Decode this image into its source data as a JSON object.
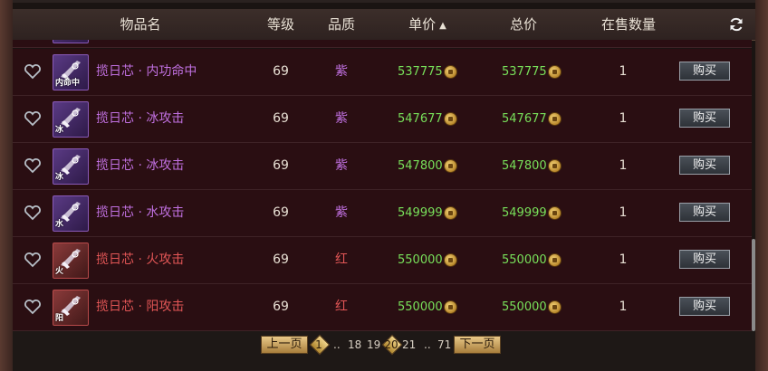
{
  "header": {
    "col_name": "物品名",
    "col_level": "等级",
    "col_quality": "品质",
    "col_unit_price": "单价",
    "col_total_price": "总价",
    "col_quantity": "在售数量",
    "sort_icon": "▲",
    "refresh_icon": "refresh-icon"
  },
  "rows": [
    {
      "name": "揽日芯 · 内功命中",
      "icon_label": "内命中",
      "level": "69",
      "quality": "紫",
      "unit_price": "537775",
      "total_price": "537775",
      "quantity": "1",
      "buy": "购买",
      "color": "#c070e0"
    },
    {
      "name": "揽日芯 · 冰攻击",
      "icon_label": "冰",
      "level": "69",
      "quality": "紫",
      "unit_price": "547677",
      "total_price": "547677",
      "quantity": "1",
      "buy": "购买",
      "color": "#c070e0"
    },
    {
      "name": "揽日芯 · 冰攻击",
      "icon_label": "冰",
      "level": "69",
      "quality": "紫",
      "unit_price": "547800",
      "total_price": "547800",
      "quantity": "1",
      "buy": "购买",
      "color": "#c070e0"
    },
    {
      "name": "揽日芯 · 水攻击",
      "icon_label": "水",
      "level": "69",
      "quality": "紫",
      "unit_price": "549999",
      "total_price": "549999",
      "quantity": "1",
      "buy": "购买",
      "color": "#c070e0"
    },
    {
      "name": "揽日芯 · 火攻击",
      "icon_label": "火",
      "level": "69",
      "quality": "红",
      "unit_price": "550000",
      "total_price": "550000",
      "quantity": "1",
      "buy": "购买",
      "color": "#e25656"
    },
    {
      "name": "揽日芯 · 阳攻击",
      "icon_label": "阳",
      "level": "69",
      "quality": "红",
      "unit_price": "550000",
      "total_price": "550000",
      "quantity": "1",
      "buy": "购买",
      "color": "#e25656"
    }
  ],
  "pagination": {
    "prev": "上一页",
    "next": "下一页",
    "first": "1",
    "ellipsis1": "..",
    "p18": "18",
    "p19": "19",
    "current": "20",
    "p21": "21",
    "ellipsis2": "..",
    "last": "71"
  }
}
